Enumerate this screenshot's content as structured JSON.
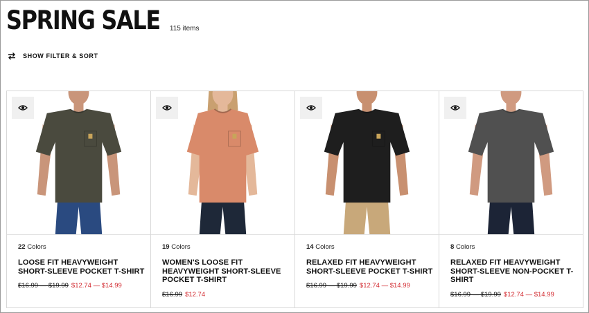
{
  "header": {
    "title": "SPRING SALE",
    "count": "115 items"
  },
  "filter": {
    "label": "SHOW FILTER & SORT"
  },
  "products": [
    {
      "color_count": "22",
      "colors_label": "Colors",
      "name": "LOOSE FIT HEAVYWEIGHT SHORT-SLEEVE POCKET T-SHIRT",
      "orig_price": "$16.99 — $19.99",
      "sale_price": "$12.74 — $14.99",
      "shirt_color": "#4a4a3e",
      "pants_color": "#2a4a80",
      "skin_color": "#c9957a",
      "hair_color": "#8a6a4a"
    },
    {
      "color_count": "19",
      "colors_label": "Colors",
      "name": "WOMEN'S LOOSE FIT HEAVYWEIGHT SHORT-SLEEVE POCKET T-SHIRT",
      "orig_price": "$16.99",
      "sale_price": "$12.74",
      "shirt_color": "#d98a6a",
      "pants_color": "#1e2838",
      "skin_color": "#e4b89a",
      "hair_color": "#c9a070"
    },
    {
      "color_count": "14",
      "colors_label": "Colors",
      "name": "RELAXED FIT HEAVYWEIGHT SHORT-SLEEVE POCKET T-SHIRT",
      "orig_price": "$16.99 — $19.99",
      "sale_price": "$12.74 — $14.99",
      "shirt_color": "#1e1e1e",
      "pants_color": "#c8a87a",
      "skin_color": "#c89070",
      "hair_color": "#3a2a20"
    },
    {
      "color_count": "8",
      "colors_label": "Colors",
      "name": "RELAXED FIT HEAVYWEIGHT SHORT-SLEEVE NON-POCKET T-SHIRT",
      "orig_price": "$16.99 — $19.99",
      "sale_price": "$12.74 — $14.99",
      "shirt_color": "#505050",
      "pants_color": "#1c2436",
      "skin_color": "#d09a80",
      "hair_color": "#9a6a40"
    }
  ],
  "colors": {
    "sale": "#d2292f",
    "eye_bg": "#f0f0f0"
  }
}
